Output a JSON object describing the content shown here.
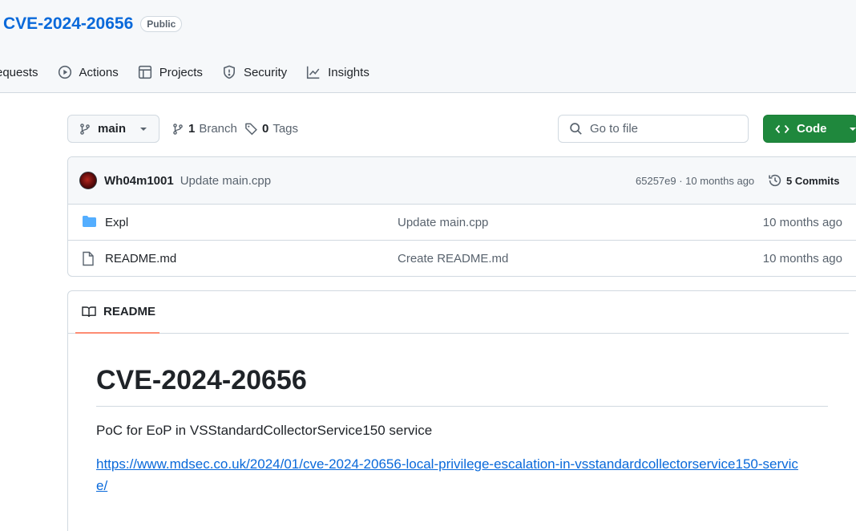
{
  "repo": {
    "name": "CVE-2024-20656",
    "visibility": "Public"
  },
  "tabs": [
    {
      "label": "equests",
      "icon": "pull-request-icon"
    },
    {
      "label": "Actions",
      "icon": "play-icon"
    },
    {
      "label": "Projects",
      "icon": "table-icon"
    },
    {
      "label": "Security",
      "icon": "shield-icon"
    },
    {
      "label": "Insights",
      "icon": "graph-icon"
    }
  ],
  "toolbar": {
    "branch": "main",
    "branch_count": "1",
    "branch_label": "Branch",
    "tag_count": "0",
    "tag_label": "Tags",
    "search_placeholder": "Go to file",
    "code_label": "Code"
  },
  "latest_commit": {
    "author": "Wh04m1001",
    "message": "Update main.cpp",
    "meta": "65257e9 · 10 months ago",
    "commits_label": "5 Commits"
  },
  "files": [
    {
      "name": "Expl",
      "type": "folder",
      "commit": "Update main.cpp",
      "date": "10 months ago"
    },
    {
      "name": "README.md",
      "type": "file",
      "commit": "Create README.md",
      "date": "10 months ago"
    }
  ],
  "readme": {
    "tab_label": "README",
    "heading": "CVE-2024-20656",
    "paragraph": "PoC for EoP in VSStandardCollectorService150 service",
    "link": "https://www.mdsec.co.uk/2024/01/cve-2024-20656-local-privilege-escalation-in-vsstandardcollectorservice150-service/"
  },
  "colors": {
    "link": "#0969da",
    "code_button": "#1f883d",
    "tab_underline": "#fd8c73",
    "folder": "#54aeff"
  }
}
